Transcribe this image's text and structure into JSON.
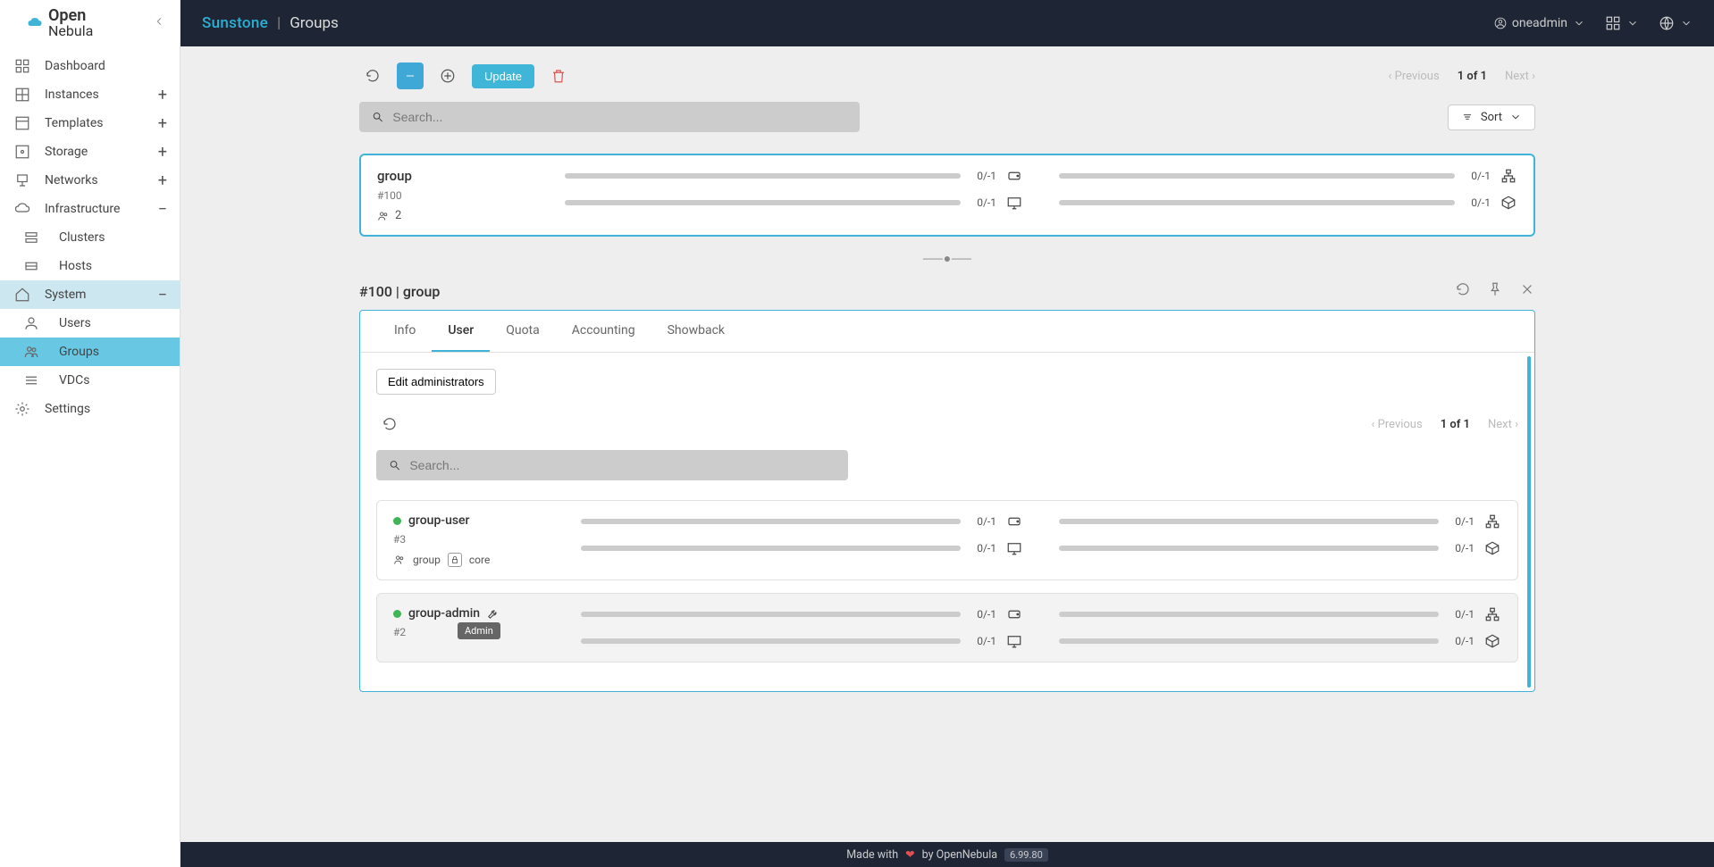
{
  "brand": {
    "line1": "Open",
    "line2": "Nebula"
  },
  "header": {
    "app": "Sunstone",
    "page": "Groups",
    "user": "oneadmin"
  },
  "sidebar": {
    "items": [
      {
        "label": "Dashboard",
        "icon": "dashboard"
      },
      {
        "label": "Instances",
        "icon": "grid",
        "expandable": true
      },
      {
        "label": "Templates",
        "icon": "templates",
        "expandable": true
      },
      {
        "label": "Storage",
        "icon": "storage",
        "expandable": true
      },
      {
        "label": "Networks",
        "icon": "networks",
        "expandable": true
      },
      {
        "label": "Infrastructure",
        "icon": "infra",
        "expanded": true,
        "children": [
          {
            "label": "Clusters",
            "icon": "clusters"
          },
          {
            "label": "Hosts",
            "icon": "hosts"
          }
        ]
      },
      {
        "label": "System",
        "icon": "system",
        "expanded": true,
        "active": true,
        "children": [
          {
            "label": "Users",
            "icon": "user"
          },
          {
            "label": "Groups",
            "icon": "groups",
            "selected": true
          },
          {
            "label": "VDCs",
            "icon": "vdcs"
          }
        ]
      },
      {
        "label": "Settings",
        "icon": "settings"
      }
    ]
  },
  "toolbar": {
    "update_label": "Update",
    "sort_label": "Sort"
  },
  "pagination": {
    "prev": "Previous",
    "next": "Next",
    "page": "1 of 1"
  },
  "search": {
    "placeholder": "Search..."
  },
  "group_card": {
    "name": "group",
    "id": "#100",
    "member_count": "2",
    "quotas": [
      {
        "val": "0/-1",
        "icon": "disk"
      },
      {
        "val": "0/-1",
        "icon": "monitor"
      },
      {
        "val": "0/-1",
        "icon": "network"
      },
      {
        "val": "0/-1",
        "icon": "cube"
      }
    ]
  },
  "detail": {
    "title": "#100 | group",
    "tabs": [
      "Info",
      "User",
      "Quota",
      "Accounting",
      "Showback"
    ],
    "active_tab": "User",
    "edit_admins_label": "Edit administrators",
    "pagination": {
      "prev": "Previous",
      "next": "Next",
      "page": "1 of 1"
    },
    "search": {
      "placeholder": "Search..."
    },
    "users": [
      {
        "name": "group-user",
        "id": "#3",
        "group": "group",
        "auth": "core",
        "admin": false,
        "quotas": [
          {
            "val": "0/-1"
          },
          {
            "val": "0/-1"
          },
          {
            "val": "0/-1"
          },
          {
            "val": "0/-1"
          }
        ]
      },
      {
        "name": "group-admin",
        "id": "#2",
        "admin": true,
        "tooltip": "Admin",
        "quotas": [
          {
            "val": "0/-1"
          },
          {
            "val": "0/-1"
          },
          {
            "val": "0/-1"
          },
          {
            "val": "0/-1"
          }
        ]
      }
    ]
  },
  "footer": {
    "made": "Made with",
    "by": "by OpenNebula",
    "version": "6.99.80"
  }
}
